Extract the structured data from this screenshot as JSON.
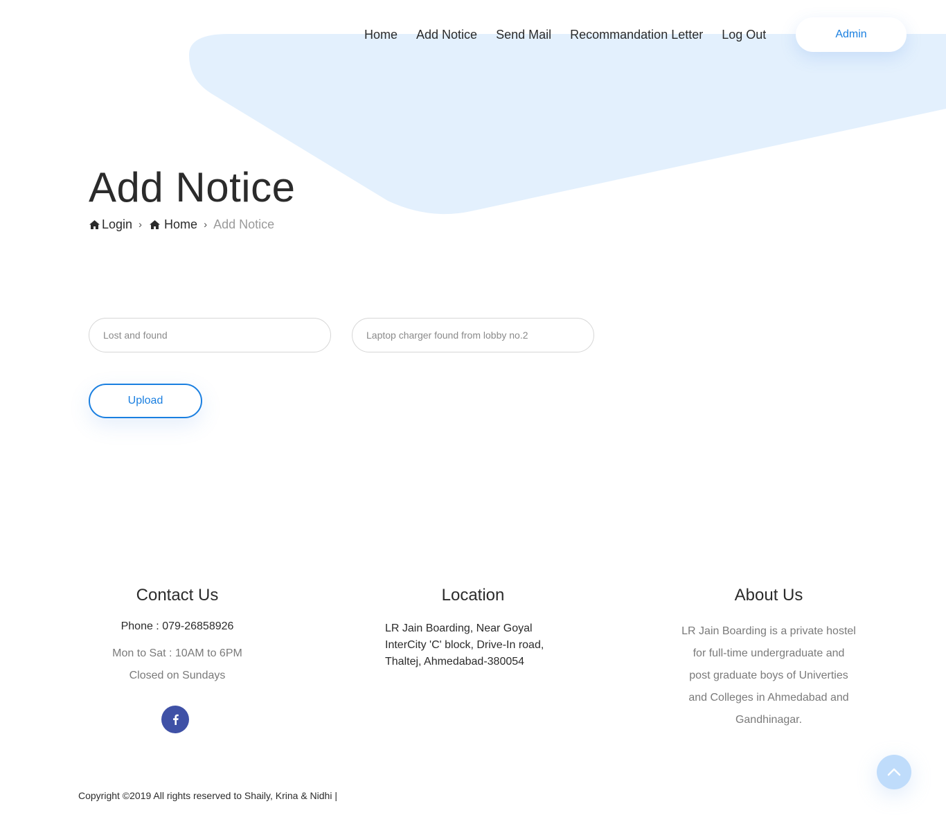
{
  "nav": {
    "items": [
      {
        "label": "Home"
      },
      {
        "label": "Add Notice"
      },
      {
        "label": "Send Mail"
      },
      {
        "label": "Recommandation Letter"
      },
      {
        "label": "Log Out"
      }
    ],
    "admin_label": "Admin"
  },
  "hero": {
    "title": "Add Notice",
    "breadcrumb": {
      "login": "Login",
      "home": "Home",
      "current": "Add Notice"
    }
  },
  "form": {
    "notice_type_placeholder": "Lost and found",
    "notice_text_placeholder": "Laptop charger found from lobby no.2",
    "upload_label": "Upload"
  },
  "footer": {
    "contact": {
      "title": "Contact Us",
      "phone": "Phone : 079-26858926",
      "hours_line1": "Mon to Sat : 10AM to 6PM",
      "hours_line2": "Closed on Sundays",
      "social_icon": "facebook-icon"
    },
    "location": {
      "title": "Location",
      "line1": "LR Jain Boarding, Near Goyal",
      "line2": "InterCity 'C' block, Drive-In road,",
      "line3": "Thaltej, Ahmedabad-380054"
    },
    "about": {
      "title": "About Us",
      "line1": "LR Jain Boarding is a private hostel",
      "line2": "for full-time undergraduate and",
      "line3": "post graduate boys of Univerties",
      "line4": "and Colleges in Ahmedabad and",
      "line5": "Gandhinagar."
    },
    "copyright": "Copyright ©2019 All rights reserved to Shaily, Krina & Nidhi |"
  },
  "colors": {
    "accent": "#1a7fe0",
    "shape": "#e3f0fd",
    "facebook": "#3f51a6",
    "to_top": "#bfdcfb"
  }
}
